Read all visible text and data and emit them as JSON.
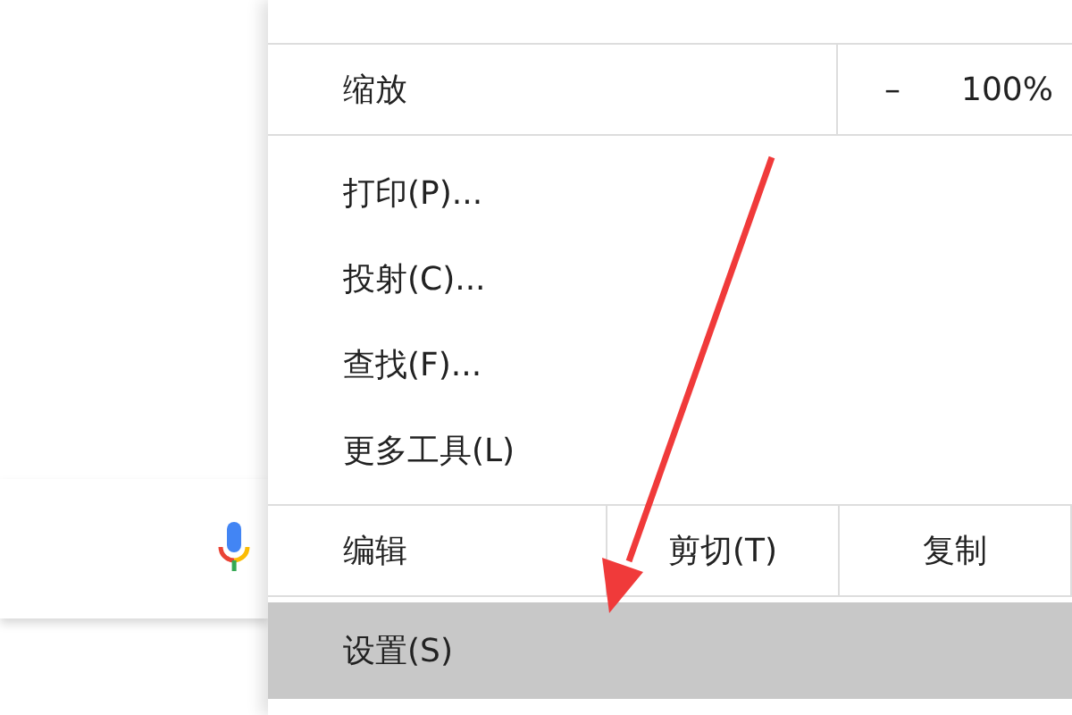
{
  "menu": {
    "items": [
      {
        "kind": "zoom",
        "label": "缩放",
        "minus": "–",
        "value": "100%"
      },
      {
        "kind": "item",
        "label": "打印(P)...",
        "selected": false
      },
      {
        "kind": "item",
        "label": "投射(C)...",
        "selected": false
      },
      {
        "kind": "item",
        "label": "查找(F)...",
        "selected": false
      },
      {
        "kind": "item",
        "label": "更多工具(L)",
        "selected": false
      },
      {
        "kind": "edit",
        "label": "编辑",
        "actions": [
          "剪切(T)",
          "复制"
        ]
      },
      {
        "kind": "item",
        "label": "设置(S)",
        "selected": true
      }
    ]
  }
}
